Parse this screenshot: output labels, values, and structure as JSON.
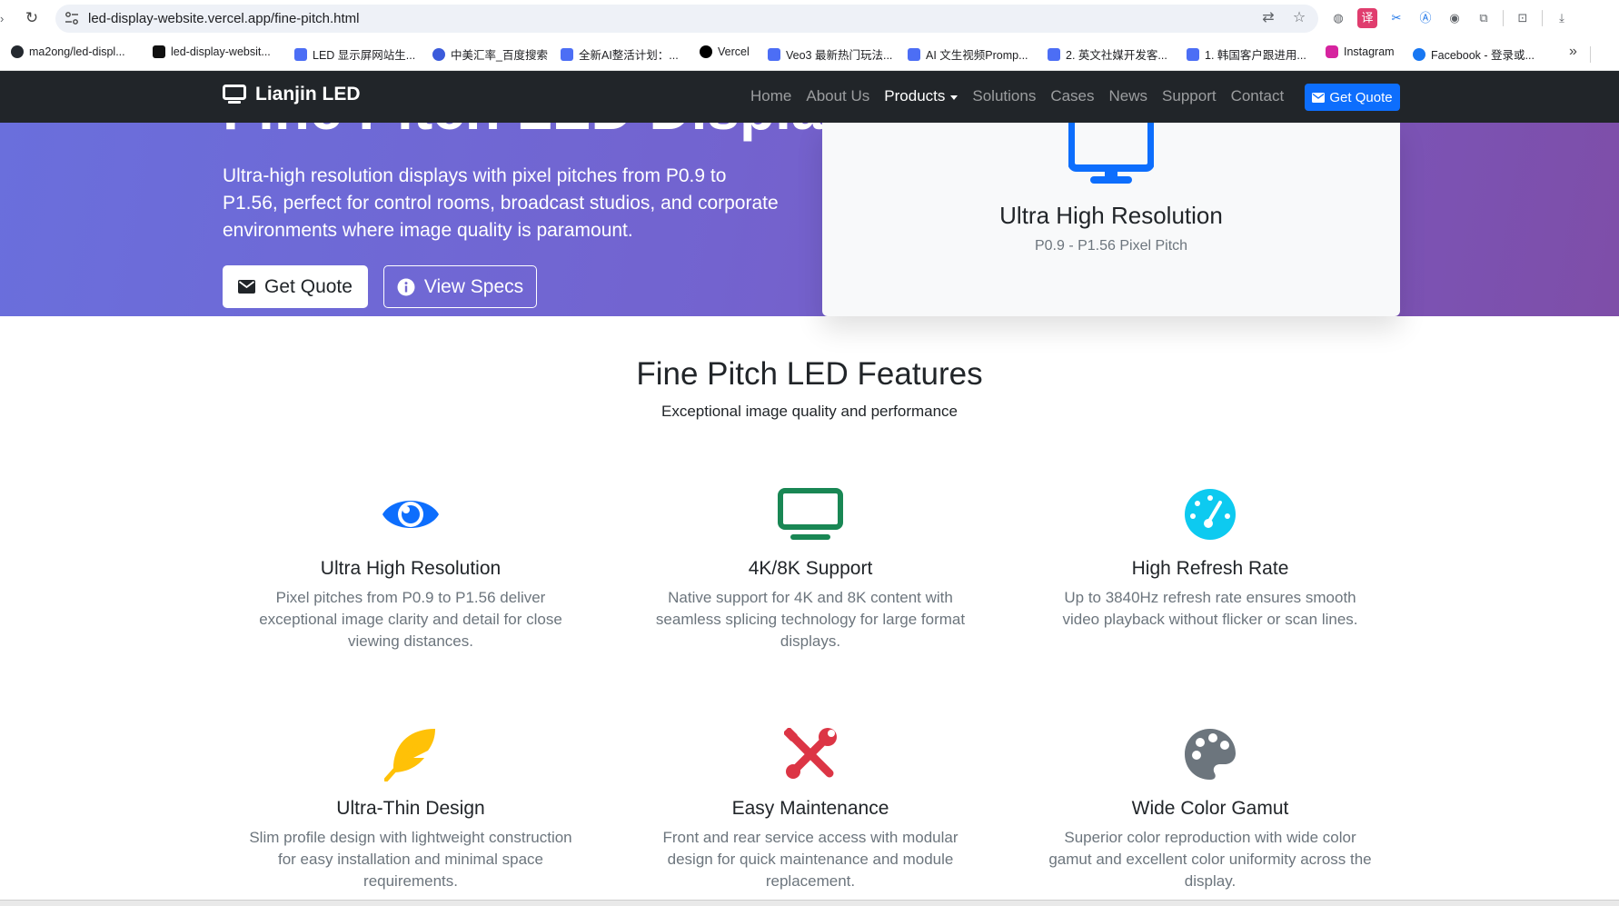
{
  "browser": {
    "url": "led-display-website.vercel.app/fine-pitch.html",
    "bookmarks": [
      {
        "label": "ma2ong/led-displ...",
        "color": "#24292f"
      },
      {
        "label": "led-display-websit...",
        "color": "#111111"
      },
      {
        "label": "LED 显示屏网站生...",
        "color": "#4c6ef5"
      },
      {
        "label": "中美汇率_百度搜索",
        "color": "#3b5bdb"
      },
      {
        "label": "全新AI整活计划：...",
        "color": "#4c6ef5"
      },
      {
        "label": "Vercel",
        "color": "#000000"
      },
      {
        "label": "Veo3 最新热门玩法...",
        "color": "#4c6ef5"
      },
      {
        "label": "AI 文生视频Promp...",
        "color": "#4c6ef5"
      },
      {
        "label": "2. 英文社媒开发客...",
        "color": "#4c6ef5"
      },
      {
        "label": "1. 韩国客户跟进用...",
        "color": "#4c6ef5"
      },
      {
        "label": "Instagram",
        "color": "#d6249f"
      },
      {
        "label": "Facebook - 登录或...",
        "color": "#1877f2"
      }
    ]
  },
  "nav": {
    "brand": "Lianjin LED",
    "items": [
      "Home",
      "About Us",
      "Products",
      "Solutions",
      "Cases",
      "News",
      "Support",
      "Contact"
    ],
    "active": "Products",
    "cta": "Get Quote"
  },
  "hero": {
    "title": "Fine Pitch LED Display",
    "lead": "Ultra-high resolution displays with pixel pitches from P0.9 to P1.56, perfect for control rooms, broadcast studios, and corporate environments where image quality is paramount.",
    "btn_primary": "Get Quote",
    "btn_secondary": "View Specs",
    "card": {
      "title": "Ultra High Resolution",
      "subtitle": "P0.9 - P1.56 Pixel Pitch",
      "icon": "monitor-icon"
    }
  },
  "features": {
    "heading": "Fine Pitch LED Features",
    "subheading": "Exceptional image quality and performance",
    "items": [
      {
        "icon": "eye-icon",
        "color": "#0d6efd",
        "title": "Ultra High Resolution",
        "text": "Pixel pitches from P0.9 to P1.56 deliver exceptional image clarity and detail for close viewing distances."
      },
      {
        "icon": "tv-icon",
        "color": "#198754",
        "title": "4K/8K Support",
        "text": "Native support for 4K and 8K content with seamless splicing technology for large format displays."
      },
      {
        "icon": "tachometer-icon",
        "color": "#0dcaf0",
        "title": "High Refresh Rate",
        "text": "Up to 3840Hz refresh rate ensures smooth video playback without flicker or scan lines."
      },
      {
        "icon": "feather-icon",
        "color": "#ffc107",
        "title": "Ultra-Thin Design",
        "text": "Slim profile design with lightweight construction for easy installation and minimal space requirements."
      },
      {
        "icon": "tools-icon",
        "color": "#dc3545",
        "title": "Easy Maintenance",
        "text": "Front and rear service access with modular design for quick maintenance and module replacement."
      },
      {
        "icon": "palette-icon",
        "color": "#6c757d",
        "title": "Wide Color Gamut",
        "text": "Superior color reproduction with wide color gamut and excellent color uniformity across the display."
      }
    ]
  }
}
